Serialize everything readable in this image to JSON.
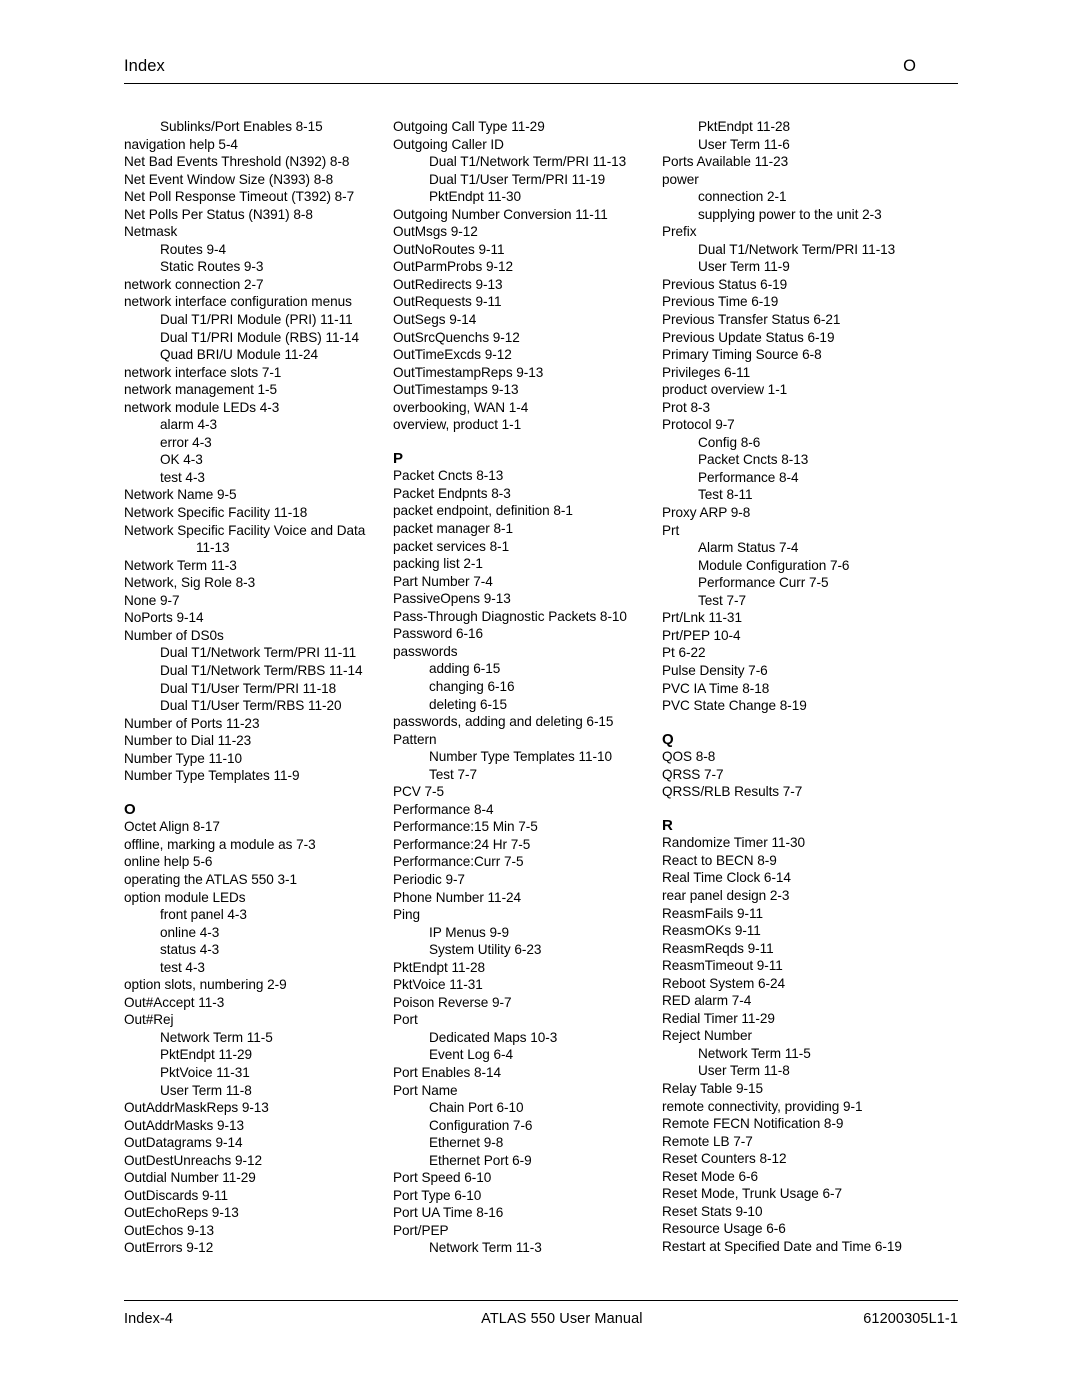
{
  "header": {
    "left": "Index",
    "right": "O"
  },
  "footer": {
    "left": "Index-4",
    "center": "ATLAS 550 User Manual",
    "right": "61200305L1-1"
  },
  "columns": [
    {
      "name": "column-1",
      "blocks": [
        {
          "type": "entries",
          "items": [
            {
              "level": 2,
              "text": "Sublinks/Port Enables  8-15"
            },
            {
              "level": 1,
              "text": "navigation help  5-4"
            },
            {
              "level": 1,
              "text": "Net Bad Events Threshold (N392)  8-8"
            },
            {
              "level": 1,
              "text": "Net Event Window Size (N393)  8-8"
            },
            {
              "level": 1,
              "text": "Net Poll Response Timeout (T392)  8-7"
            },
            {
              "level": 1,
              "text": "Net Polls Per Status (N391)  8-8"
            },
            {
              "level": 1,
              "text": "Netmask"
            },
            {
              "level": 2,
              "text": "Routes  9-4"
            },
            {
              "level": 2,
              "text": "Static Routes  9-3"
            },
            {
              "level": 1,
              "text": "network connection  2-7"
            },
            {
              "level": 1,
              "text": "network interface configuration menus"
            },
            {
              "level": 2,
              "text": "Dual T1/PRI Module (PRI)  11-11"
            },
            {
              "level": 2,
              "text": "Dual T1/PRI Module (RBS)  11-14"
            },
            {
              "level": 2,
              "text": "Quad BRI/U Module  11-24"
            },
            {
              "level": 1,
              "text": "network interface slots 7-1"
            },
            {
              "level": 1,
              "text": "network management  1-5"
            },
            {
              "level": 1,
              "text": "network module LEDs  4-3"
            },
            {
              "level": 2,
              "text": "alarm  4-3"
            },
            {
              "level": 2,
              "text": "error  4-3"
            },
            {
              "level": 2,
              "text": "OK  4-3"
            },
            {
              "level": 2,
              "text": "test  4-3"
            },
            {
              "level": 1,
              "text": "Network Name  9-5"
            },
            {
              "level": 1,
              "text": "Network Specific Facility  11-18"
            },
            {
              "level": 1,
              "text": "Network Specific Facility Voice and Data"
            },
            {
              "level": 3,
              "text": "11-13"
            },
            {
              "level": 1,
              "text": "Network Term  11-3"
            },
            {
              "level": 1,
              "text": "Network, Sig Role  8-3"
            },
            {
              "level": 1,
              "text": "None  9-7"
            },
            {
              "level": 1,
              "text": "NoPorts  9-14"
            },
            {
              "level": 1,
              "text": "Number of DS0s"
            },
            {
              "level": 2,
              "text": "Dual T1/Network Term/PRI  11-11"
            },
            {
              "level": 2,
              "text": "Dual T1/Network Term/RBS  11-14"
            },
            {
              "level": 2,
              "text": "Dual T1/User Term/PRI  11-18"
            },
            {
              "level": 2,
              "text": "Dual T1/User Term/RBS  11-20"
            },
            {
              "level": 1,
              "text": "Number of Ports  11-23"
            },
            {
              "level": 1,
              "text": "Number to Dial  11-23"
            },
            {
              "level": 1,
              "text": "Number Type  11-10"
            },
            {
              "level": 1,
              "text": "Number Type Templates  11-9"
            }
          ]
        },
        {
          "type": "letter",
          "text": "O"
        },
        {
          "type": "entries",
          "items": [
            {
              "level": 1,
              "text": "Octet Align  8-17"
            },
            {
              "level": 1,
              "text": "offline, marking a module as  7-3"
            },
            {
              "level": 1,
              "text": "online help  5-6"
            },
            {
              "level": 1,
              "text": "operating the ATLAS 550  3-1"
            },
            {
              "level": 1,
              "text": "option module LEDs"
            },
            {
              "level": 2,
              "text": "front panel  4-3"
            },
            {
              "level": 2,
              "text": "online  4-3"
            },
            {
              "level": 2,
              "text": "status  4-3"
            },
            {
              "level": 2,
              "text": "test  4-3"
            },
            {
              "level": 1,
              "text": "option slots, numbering  2-9"
            },
            {
              "level": 1,
              "text": "Out#Accept  11-3"
            },
            {
              "level": 1,
              "text": "Out#Rej"
            },
            {
              "level": 2,
              "text": "Network Term  11-5"
            },
            {
              "level": 2,
              "text": "PktEndpt  11-29"
            },
            {
              "level": 2,
              "text": "PktVoice  11-31"
            },
            {
              "level": 2,
              "text": "User Term  11-8"
            },
            {
              "level": 1,
              "text": "OutAddrMaskReps  9-13"
            },
            {
              "level": 1,
              "text": "OutAddrMasks  9-13"
            },
            {
              "level": 1,
              "text": "OutDatagrams  9-14"
            },
            {
              "level": 1,
              "text": "OutDestUnreachs  9-12"
            },
            {
              "level": 1,
              "text": "Outdial Number  11-29"
            },
            {
              "level": 1,
              "text": "OutDiscards  9-11"
            },
            {
              "level": 1,
              "text": "OutEchoReps  9-13"
            },
            {
              "level": 1,
              "text": "OutEchos  9-13"
            },
            {
              "level": 1,
              "text": "OutErrors  9-12"
            }
          ]
        }
      ]
    },
    {
      "name": "column-2",
      "blocks": [
        {
          "type": "entries",
          "items": [
            {
              "level": 1,
              "text": "Outgoing Call Type  11-29"
            },
            {
              "level": 1,
              "text": "Outgoing Caller ID"
            },
            {
              "level": 2,
              "text": "Dual T1/Network Term/PRI  11-13"
            },
            {
              "level": 2,
              "text": "Dual T1/User Term/PRI  11-19"
            },
            {
              "level": 2,
              "text": "PktEndpt  11-30"
            },
            {
              "level": 1,
              "text": "Outgoing Number Conversion  11-11"
            },
            {
              "level": 1,
              "text": "OutMsgs  9-12"
            },
            {
              "level": 1,
              "text": "OutNoRoutes  9-11"
            },
            {
              "level": 1,
              "text": "OutParmProbs  9-12"
            },
            {
              "level": 1,
              "text": "OutRedirects  9-13"
            },
            {
              "level": 1,
              "text": "OutRequests  9-11"
            },
            {
              "level": 1,
              "text": "OutSegs  9-14"
            },
            {
              "level": 1,
              "text": "OutSrcQuenchs  9-12"
            },
            {
              "level": 1,
              "text": "OutTimeExcds  9-12"
            },
            {
              "level": 1,
              "text": "OutTimestampReps  9-13"
            },
            {
              "level": 1,
              "text": "OutTimestamps  9-13"
            },
            {
              "level": 1,
              "text": "overbooking, WAN  1-4"
            },
            {
              "level": 1,
              "text": "overview, product  1-1"
            }
          ]
        },
        {
          "type": "letter",
          "text": "P"
        },
        {
          "type": "entries",
          "items": [
            {
              "level": 1,
              "text": "Packet Cncts  8-13"
            },
            {
              "level": 1,
              "text": "Packet Endpnts  8-3"
            },
            {
              "level": 1,
              "text": "packet endpoint, definition  8-1"
            },
            {
              "level": 1,
              "text": "packet manager  8-1"
            },
            {
              "level": 1,
              "text": "packet services  8-1"
            },
            {
              "level": 1,
              "text": "packing list  2-1"
            },
            {
              "level": 1,
              "text": "Part Number  7-4"
            },
            {
              "level": 1,
              "text": "PassiveOpens  9-13"
            },
            {
              "level": 1,
              "text": "Pass-Through Diagnostic Packets  8-10"
            },
            {
              "level": 1,
              "text": "Password  6-16"
            },
            {
              "level": 1,
              "text": "passwords"
            },
            {
              "level": 2,
              "text": "adding  6-15"
            },
            {
              "level": 2,
              "text": "changing  6-16"
            },
            {
              "level": 2,
              "text": "deleting  6-15"
            },
            {
              "level": 1,
              "text": "passwords, adding and deleting  6-15"
            },
            {
              "level": 1,
              "text": "Pattern"
            },
            {
              "level": 2,
              "text": "Number Type Templates  11-10"
            },
            {
              "level": 2,
              "text": "Test  7-7"
            },
            {
              "level": 1,
              "text": "PCV  7-5"
            },
            {
              "level": 1,
              "text": "Performance  8-4"
            },
            {
              "level": 1,
              "text": "Performance:15 Min  7-5"
            },
            {
              "level": 1,
              "text": "Performance:24 Hr  7-5"
            },
            {
              "level": 1,
              "text": "Performance:Curr  7-5"
            },
            {
              "level": 1,
              "text": "Periodic  9-7"
            },
            {
              "level": 1,
              "text": "Phone Number  11-24"
            },
            {
              "level": 1,
              "text": "Ping"
            },
            {
              "level": 2,
              "text": "IP Menus  9-9"
            },
            {
              "level": 2,
              "text": "System Utility  6-23"
            },
            {
              "level": 1,
              "text": "PktEndpt  11-28"
            },
            {
              "level": 1,
              "text": "PktVoice  11-31"
            },
            {
              "level": 1,
              "text": "Poison Reverse  9-7"
            },
            {
              "level": 1,
              "text": "Port"
            },
            {
              "level": 2,
              "text": "Dedicated Maps  10-3"
            },
            {
              "level": 2,
              "text": "Event Log  6-4"
            },
            {
              "level": 1,
              "text": "Port Enables  8-14"
            },
            {
              "level": 1,
              "text": "Port Name"
            },
            {
              "level": 2,
              "text": "Chain Port  6-10"
            },
            {
              "level": 2,
              "text": "Configuration  7-6"
            },
            {
              "level": 2,
              "text": "Ethernet  9-8"
            },
            {
              "level": 2,
              "text": "Ethernet Port  6-9"
            },
            {
              "level": 1,
              "text": "Port Speed  6-10"
            },
            {
              "level": 1,
              "text": "Port Type  6-10"
            },
            {
              "level": 1,
              "text": "Port UA Time  8-16"
            },
            {
              "level": 1,
              "text": "Port/PEP"
            },
            {
              "level": 2,
              "text": "Network Term  11-3"
            }
          ]
        }
      ]
    },
    {
      "name": "column-3",
      "blocks": [
        {
          "type": "entries",
          "items": [
            {
              "level": 2,
              "text": "PktEndpt  11-28"
            },
            {
              "level": 2,
              "text": "User Term  11-6"
            },
            {
              "level": 1,
              "text": "Ports Available  11-23"
            },
            {
              "level": 1,
              "text": "power"
            },
            {
              "level": 2,
              "text": "connection  2-1"
            },
            {
              "level": 2,
              "text": "supplying power to the unit  2-3"
            },
            {
              "level": 1,
              "text": "Prefix"
            },
            {
              "level": 2,
              "text": "Dual T1/Network Term/PRI  11-13"
            },
            {
              "level": 2,
              "text": "User Term  11-9"
            },
            {
              "level": 1,
              "text": "Previous Status  6-19"
            },
            {
              "level": 1,
              "text": "Previous Time  6-19"
            },
            {
              "level": 1,
              "text": "Previous Transfer Status  6-21"
            },
            {
              "level": 1,
              "text": "Previous Update Status  6-19"
            },
            {
              "level": 1,
              "text": "Primary Timing Source  6-8"
            },
            {
              "level": 1,
              "text": "Privileges  6-11"
            },
            {
              "level": 1,
              "text": "product overview  1-1"
            },
            {
              "level": 1,
              "text": "Prot  8-3"
            },
            {
              "level": 1,
              "text": "Protocol  9-7"
            },
            {
              "level": 2,
              "text": "Config  8-6"
            },
            {
              "level": 2,
              "text": "Packet Cncts  8-13"
            },
            {
              "level": 2,
              "text": "Performance  8-4"
            },
            {
              "level": 2,
              "text": "Test  8-11"
            },
            {
              "level": 1,
              "text": "Proxy ARP  9-8"
            },
            {
              "level": 1,
              "text": "Prt"
            },
            {
              "level": 2,
              "text": "Alarm Status  7-4"
            },
            {
              "level": 2,
              "text": "Module Configuration  7-6"
            },
            {
              "level": 2,
              "text": "Performance Curr  7-5"
            },
            {
              "level": 2,
              "text": "Test  7-7"
            },
            {
              "level": 1,
              "text": "Prt/Lnk  11-31"
            },
            {
              "level": 1,
              "text": "Prt/PEP  10-4"
            },
            {
              "level": 1,
              "text": "Pt  6-22"
            },
            {
              "level": 1,
              "text": "Pulse Density  7-6"
            },
            {
              "level": 1,
              "text": "PVC IA Time  8-18"
            },
            {
              "level": 1,
              "text": "PVC State Change  8-19"
            }
          ]
        },
        {
          "type": "letter",
          "text": "Q"
        },
        {
          "type": "entries",
          "items": [
            {
              "level": 1,
              "text": "QOS  8-8"
            },
            {
              "level": 1,
              "text": "QRSS  7-7"
            },
            {
              "level": 1,
              "text": "QRSS/RLB Results  7-7"
            }
          ]
        },
        {
          "type": "letter",
          "text": "R"
        },
        {
          "type": "entries",
          "items": [
            {
              "level": 1,
              "text": "Randomize Timer  11-30"
            },
            {
              "level": 1,
              "text": "React to BECN  8-9"
            },
            {
              "level": 1,
              "text": "Real Time Clock  6-14"
            },
            {
              "level": 1,
              "text": "rear panel design  2-3"
            },
            {
              "level": 1,
              "text": "ReasmFails  9-11"
            },
            {
              "level": 1,
              "text": "ReasmOKs  9-11"
            },
            {
              "level": 1,
              "text": "ReasmReqds  9-11"
            },
            {
              "level": 1,
              "text": "ReasmTimeout  9-11"
            },
            {
              "level": 1,
              "text": "Reboot System  6-24"
            },
            {
              "level": 1,
              "text": "RED alarm  7-4"
            },
            {
              "level": 1,
              "text": "Redial Timer  11-29"
            },
            {
              "level": 1,
              "text": "Reject Number"
            },
            {
              "level": 2,
              "text": "Network Term  11-5"
            },
            {
              "level": 2,
              "text": "User Term  11-8"
            },
            {
              "level": 1,
              "text": "Relay Table  9-15"
            },
            {
              "level": 1,
              "text": "remote connectivity, providing  9-1"
            },
            {
              "level": 1,
              "text": "Remote FECN Notification  8-9"
            },
            {
              "level": 1,
              "text": "Remote LB  7-7"
            },
            {
              "level": 1,
              "text": "Reset Counters  8-12"
            },
            {
              "level": 1,
              "text": "Reset Mode  6-6"
            },
            {
              "level": 1,
              "text": "Reset Mode, Trunk Usage  6-7"
            },
            {
              "level": 1,
              "text": "Reset Stats  9-10"
            },
            {
              "level": 1,
              "text": "Resource Usage  6-6"
            },
            {
              "level": 1,
              "text": "Restart at Specified Date and Time  6-19"
            }
          ]
        }
      ]
    }
  ]
}
